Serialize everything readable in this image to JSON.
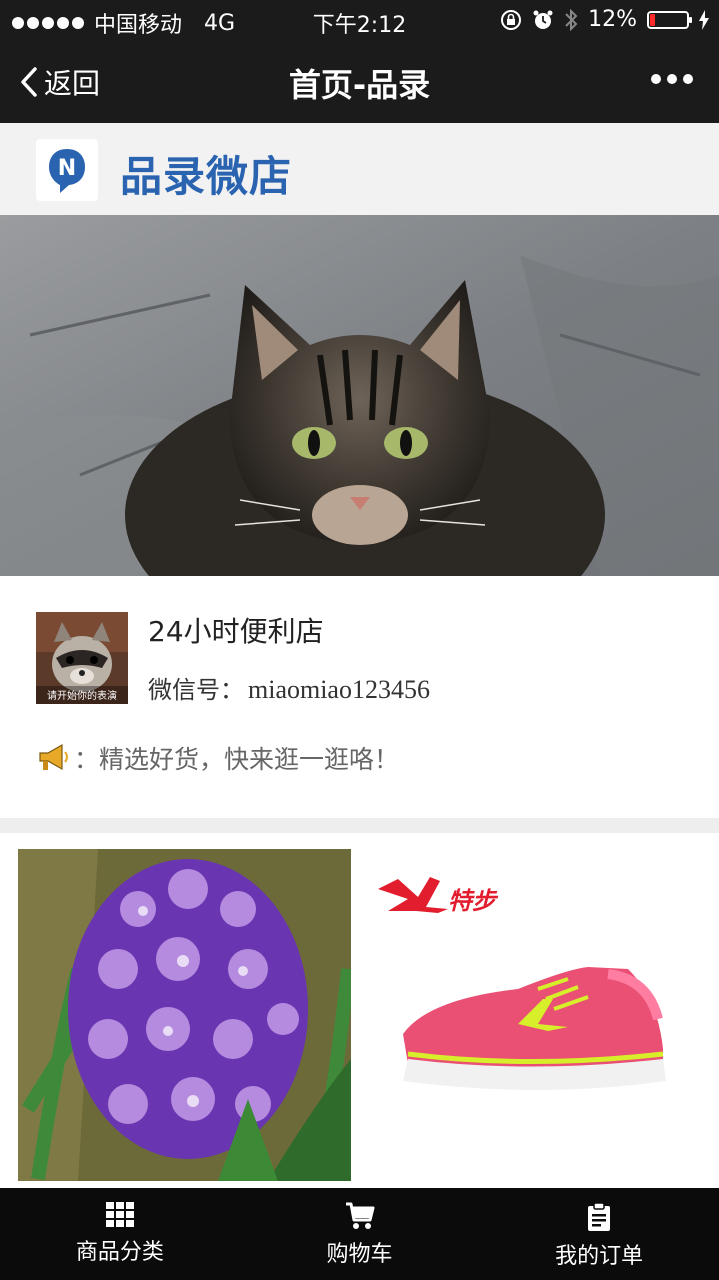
{
  "status_bar": {
    "carrier": "中国移动",
    "network": "4G",
    "time": "下午2:12",
    "battery": "12%",
    "battery_level": 0.12,
    "battery_color": "#ff2b2b"
  },
  "nav": {
    "back_label": "返回",
    "title": "首页-品录"
  },
  "shop": {
    "name": "品录微店",
    "brand_color": "#2a64b1",
    "logo_letter": "N"
  },
  "store": {
    "avatar_caption": "请开始你的表演",
    "name": "24小时便利店",
    "wechat_label": "微信号：",
    "wechat_id": "miaomiao123456",
    "notice": "：精选好货，快来逛一逛咯！"
  },
  "products": [
    {
      "image": "purple-hyacinth-flower"
    },
    {
      "image": "pink-running-shoe",
      "brand_text": "特步"
    }
  ],
  "tabs": [
    {
      "label": "商品分类",
      "icon": "grid-icon"
    },
    {
      "label": "购物车",
      "icon": "cart-icon"
    },
    {
      "label": "我的订单",
      "icon": "clipboard-icon"
    }
  ]
}
